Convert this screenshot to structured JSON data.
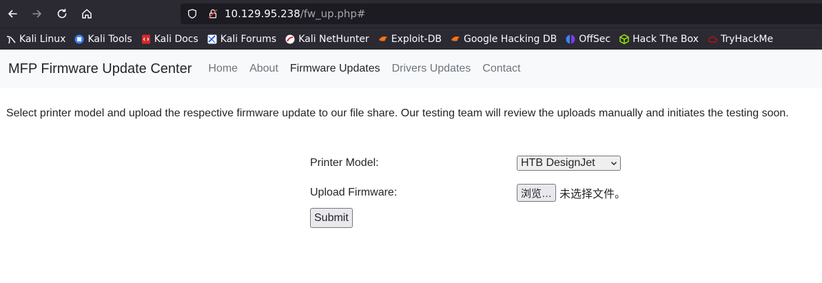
{
  "browser": {
    "url_host": "10.129.95.238",
    "url_path": "/fw_up.php#",
    "bookmarks": [
      {
        "label": "Kali Linux",
        "icon": "kali-dragon-icon"
      },
      {
        "label": "Kali Tools",
        "icon": "kali-tools-icon"
      },
      {
        "label": "Kali Docs",
        "icon": "kali-docs-icon"
      },
      {
        "label": "Kali Forums",
        "icon": "kali-forums-icon"
      },
      {
        "label": "Kali NetHunter",
        "icon": "nethunter-icon"
      },
      {
        "label": "Exploit-DB",
        "icon": "exploit-db-icon"
      },
      {
        "label": "Google Hacking DB",
        "icon": "ghdb-icon"
      },
      {
        "label": "OffSec",
        "icon": "offsec-icon"
      },
      {
        "label": "Hack The Box",
        "icon": "htb-cube-icon"
      },
      {
        "label": "TryHackMe",
        "icon": "tryhackme-icon"
      }
    ]
  },
  "site": {
    "brand": "MFP Firmware Update Center",
    "nav": {
      "home": "Home",
      "about": "About",
      "firmware": "Firmware Updates",
      "drivers": "Drivers Updates",
      "contact": "Contact"
    },
    "intro": "Select printer model and upload the respective firmware update to our file share. Our testing team will review the uploads manually and initiates the testing soon."
  },
  "form": {
    "printer_label": "Printer Model:",
    "printer_value": "HTB DesignJet",
    "upload_label": "Upload Firmware:",
    "browse_label": "浏览…",
    "file_status": "未选择文件。",
    "submit_label": "Submit"
  }
}
